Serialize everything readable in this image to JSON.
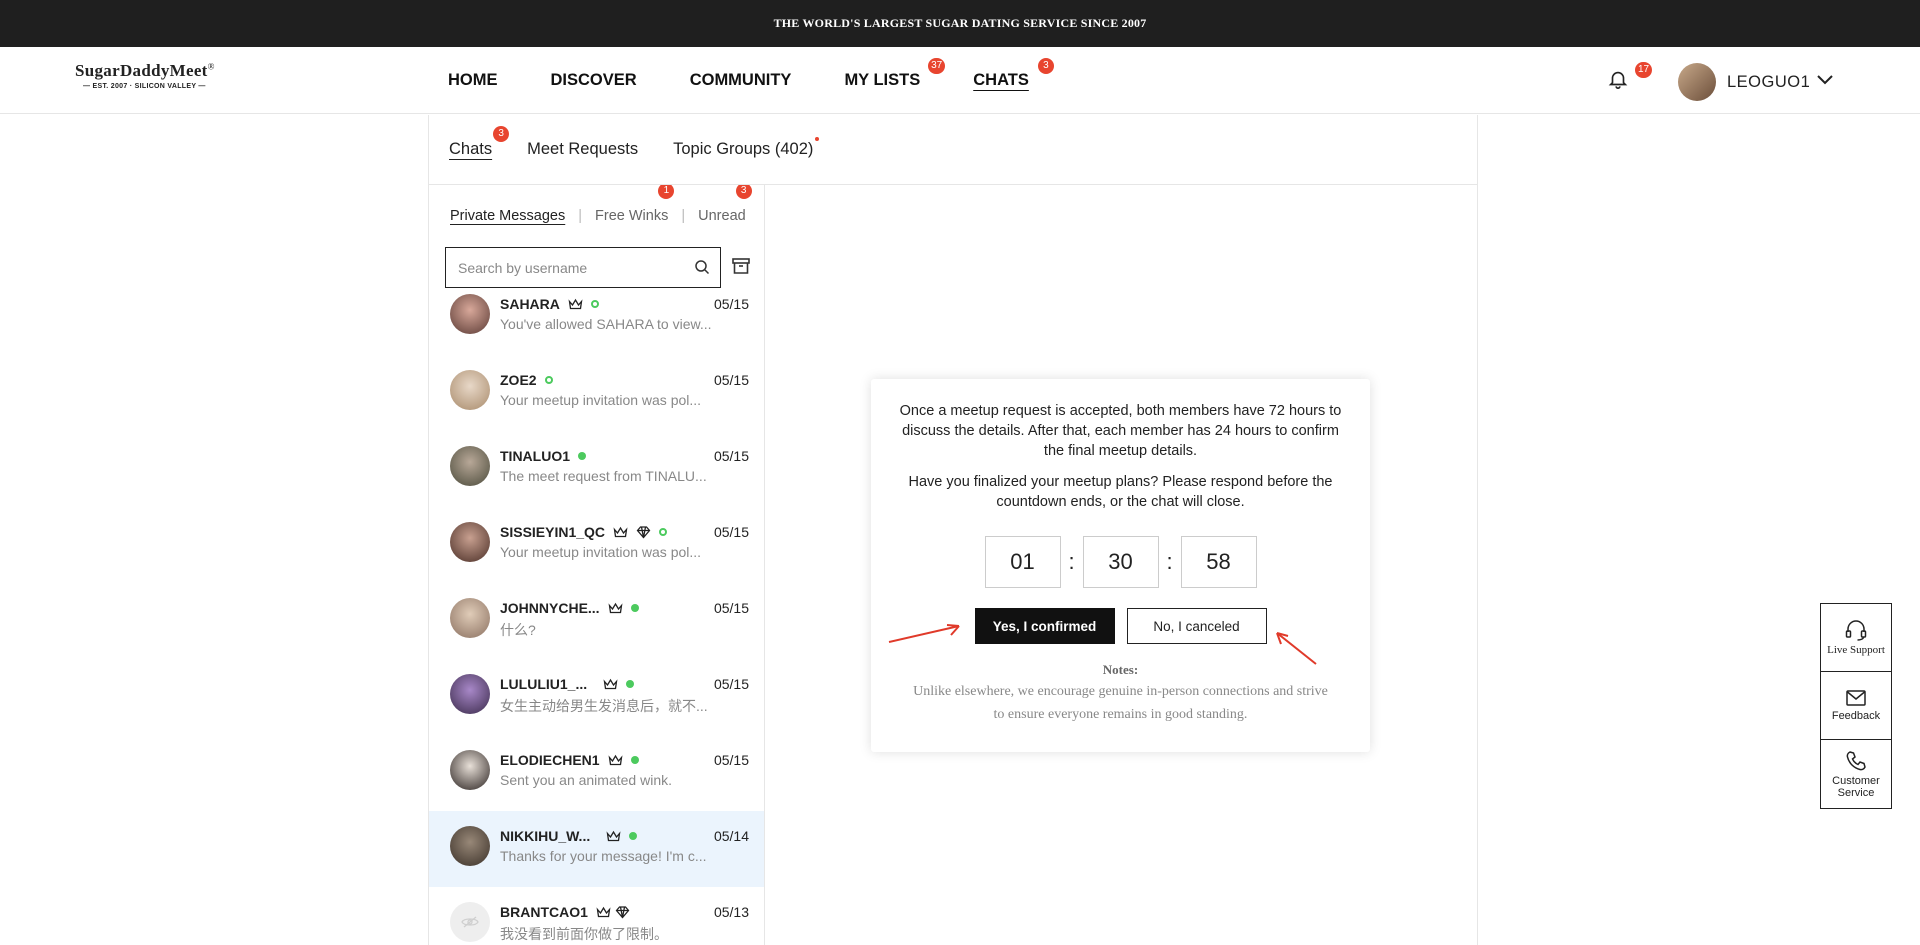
{
  "topbar": {
    "text": "THE WORLD'S LARGEST SUGAR DATING SERVICE SINCE 2007"
  },
  "logo": {
    "title": "SugarDaddyMeet",
    "reg": "®",
    "sub": "— EST. 2007 · SILICON VALLEY —"
  },
  "nav": {
    "items": [
      {
        "label": "HOME"
      },
      {
        "label": "DISCOVER"
      },
      {
        "label": "COMMUNITY"
      },
      {
        "label": "MY LISTS",
        "badge": "37"
      },
      {
        "label": "CHATS",
        "badge": "3"
      }
    ]
  },
  "notifications": {
    "badge": "17"
  },
  "user": {
    "name": "LEOGUO1"
  },
  "subtabs": {
    "chats": "Chats",
    "chats_badge": "3",
    "meet": "Meet Requests",
    "topic": "Topic Groups (402)"
  },
  "filters": {
    "private": "Private Messages",
    "winks": "Free Winks",
    "winks_badge": "1",
    "unread": "Unread",
    "unread_badge": "3"
  },
  "search": {
    "placeholder": "Search by username"
  },
  "conversations": [
    {
      "name": "SAHARA",
      "date": "05/15",
      "msg": "You've allowed SAHARA to view..."
    },
    {
      "name": "ZOE2",
      "date": "05/15",
      "msg": "Your meetup invitation was pol..."
    },
    {
      "name": "TINALUO1",
      "date": "05/15",
      "msg": "The meet request from TINALU..."
    },
    {
      "name": "SISSIEYIN1_QC",
      "date": "05/15",
      "msg": "Your meetup invitation was pol..."
    },
    {
      "name": "JOHNNYCHE...",
      "date": "05/15",
      "msg": "什么?"
    },
    {
      "name": "LULULIU1_...",
      "date": "05/15",
      "msg": "女生主动给男生发消息后，就不..."
    },
    {
      "name": "ELODIECHEN1",
      "date": "05/15",
      "msg": "Sent you an animated wink."
    },
    {
      "name": "NIKKIHU_W...",
      "date": "05/14",
      "msg": "Thanks for your message! I'm c..."
    },
    {
      "name": "BRANTCAO1",
      "date": "05/13",
      "msg": "我没看到前面你做了限制。"
    }
  ],
  "modal": {
    "p1": "Once a meetup request is accepted, both members have 72 hours to discuss the details. After that, each member has 24 hours to confirm the final meetup details.",
    "p2": "Have you finalized your meetup plans? Please respond before the countdown ends, or the chat will close.",
    "hours": "01",
    "minutes": "30",
    "seconds": "58",
    "sep": ":",
    "yes": "Yes, I confirmed",
    "no": "No, I canceled",
    "notes_title": "Notes:",
    "notes": "Unlike elsewhere, we encourage genuine in-person connections and strive to ensure everyone remains in good standing."
  },
  "side": {
    "live": "Live Support",
    "feedback": "Feedback",
    "customer": "Customer Service"
  },
  "colors": {
    "badge": "#e8452f",
    "online": "#4cca5e",
    "selected_row": "#ebf4fd",
    "topbar": "#1f1f1f",
    "arrow": "#e03a2a"
  }
}
